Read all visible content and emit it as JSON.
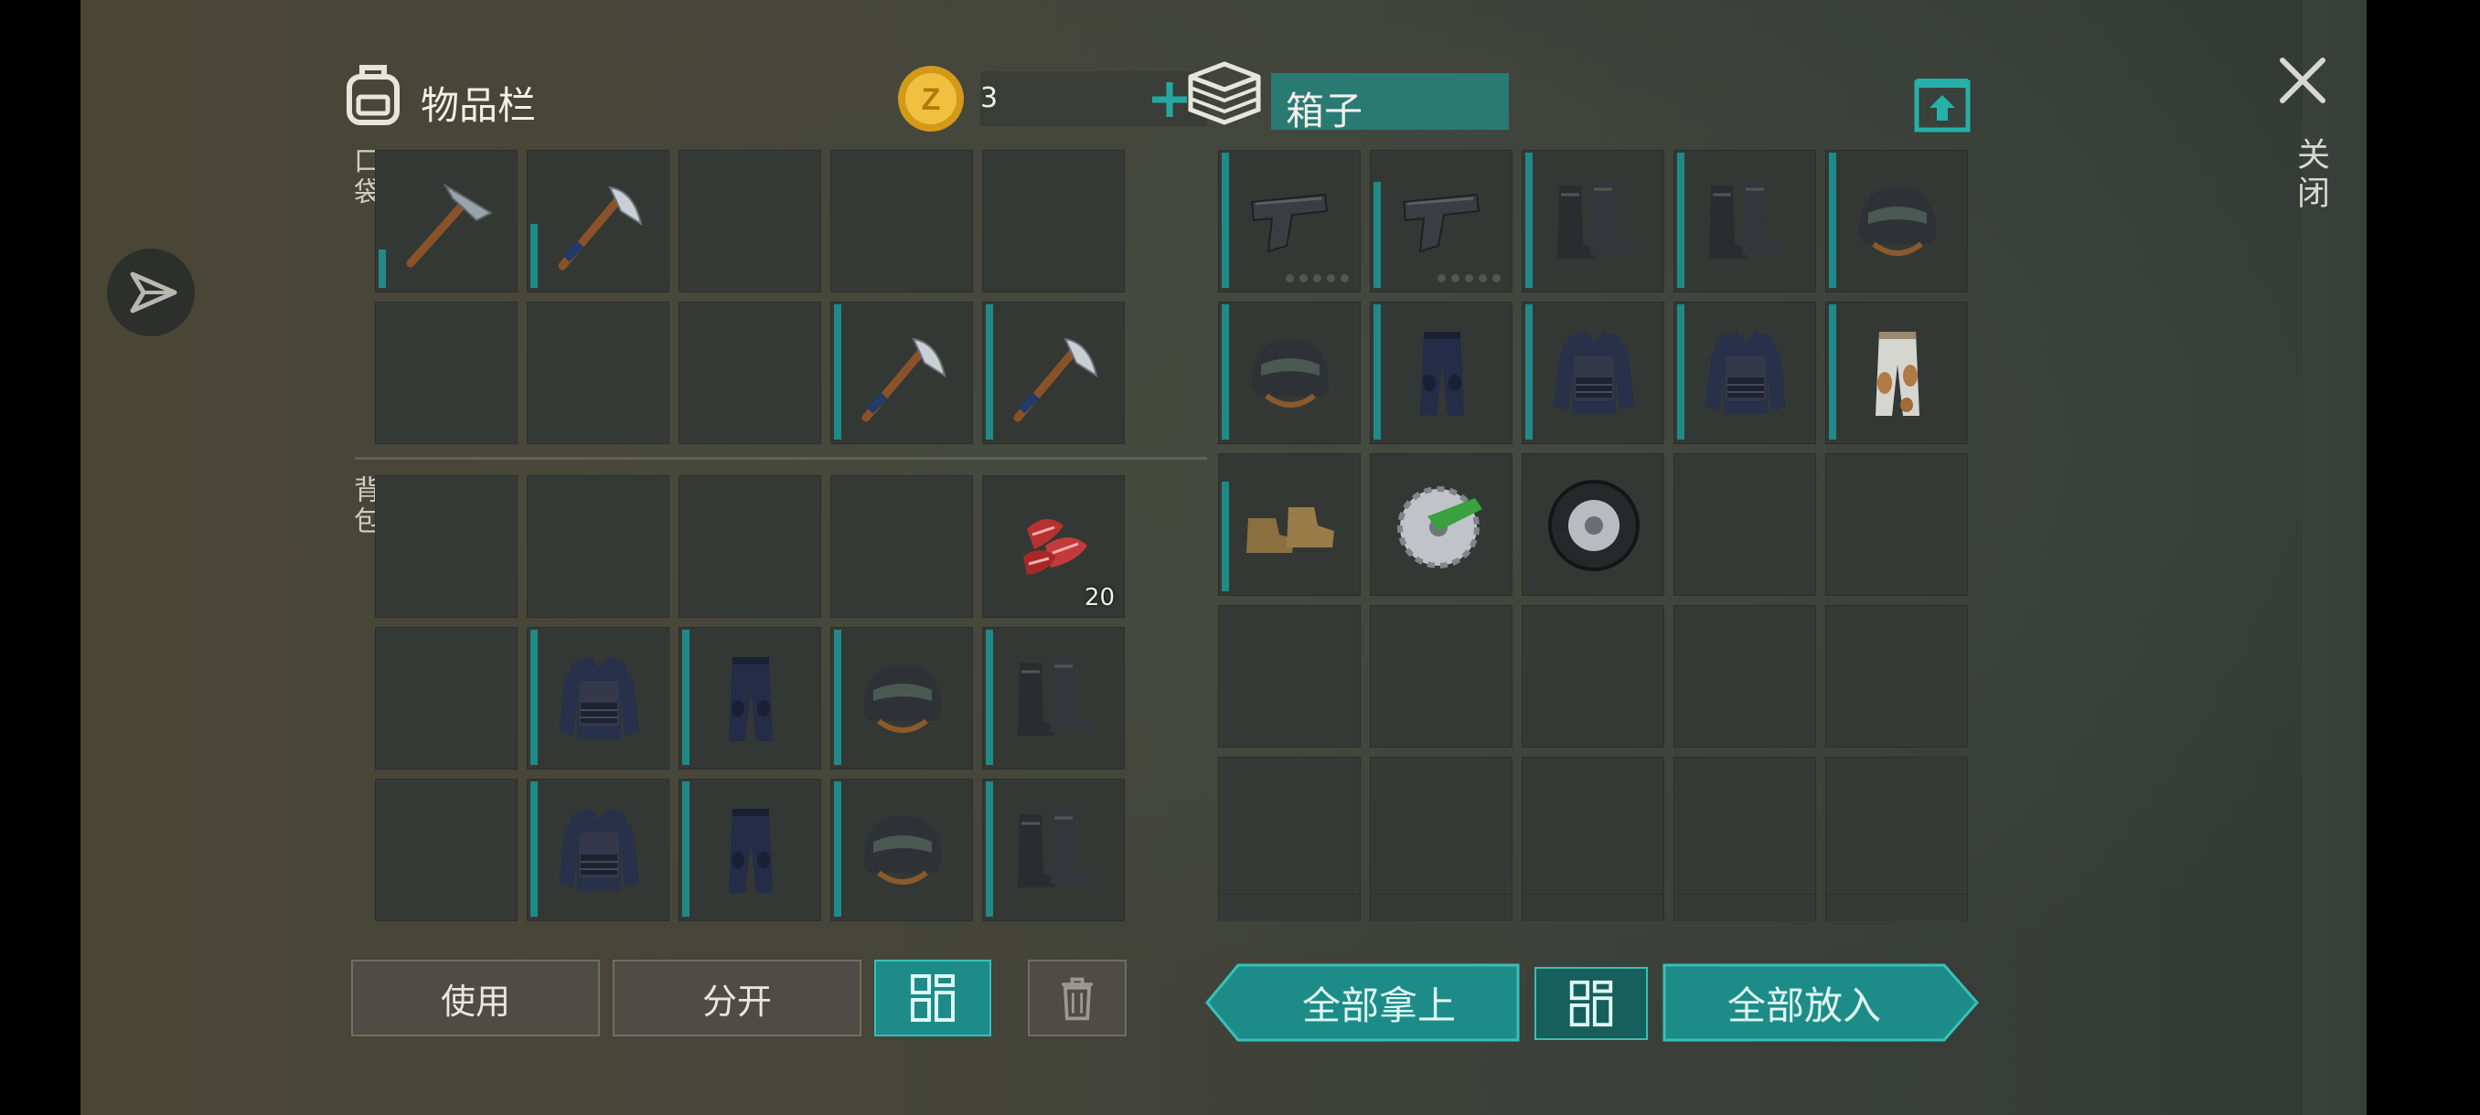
{
  "inventory": {
    "title": "物品栏",
    "coins": "3",
    "pockets_label": "口袋",
    "backpack_label": "背包",
    "meat_qty": "20"
  },
  "container": {
    "title": "箱子"
  },
  "buttons": {
    "use": "使用",
    "split": "分开",
    "take_all": "全部拿上",
    "put_all": "全部放入"
  },
  "close_label": "关闭",
  "icons": {
    "backpack": "backpack-icon",
    "coin": "coin-icon",
    "add": "plus-icon",
    "box": "box-icon",
    "upload": "upload-icon",
    "close": "close-icon",
    "send": "send-icon",
    "sort": "grid-sort-icon",
    "trash": "trash-icon"
  },
  "colors": {
    "accent": "#1d8c89",
    "accent_light": "#38c0b8",
    "coin": "#e0a820"
  }
}
